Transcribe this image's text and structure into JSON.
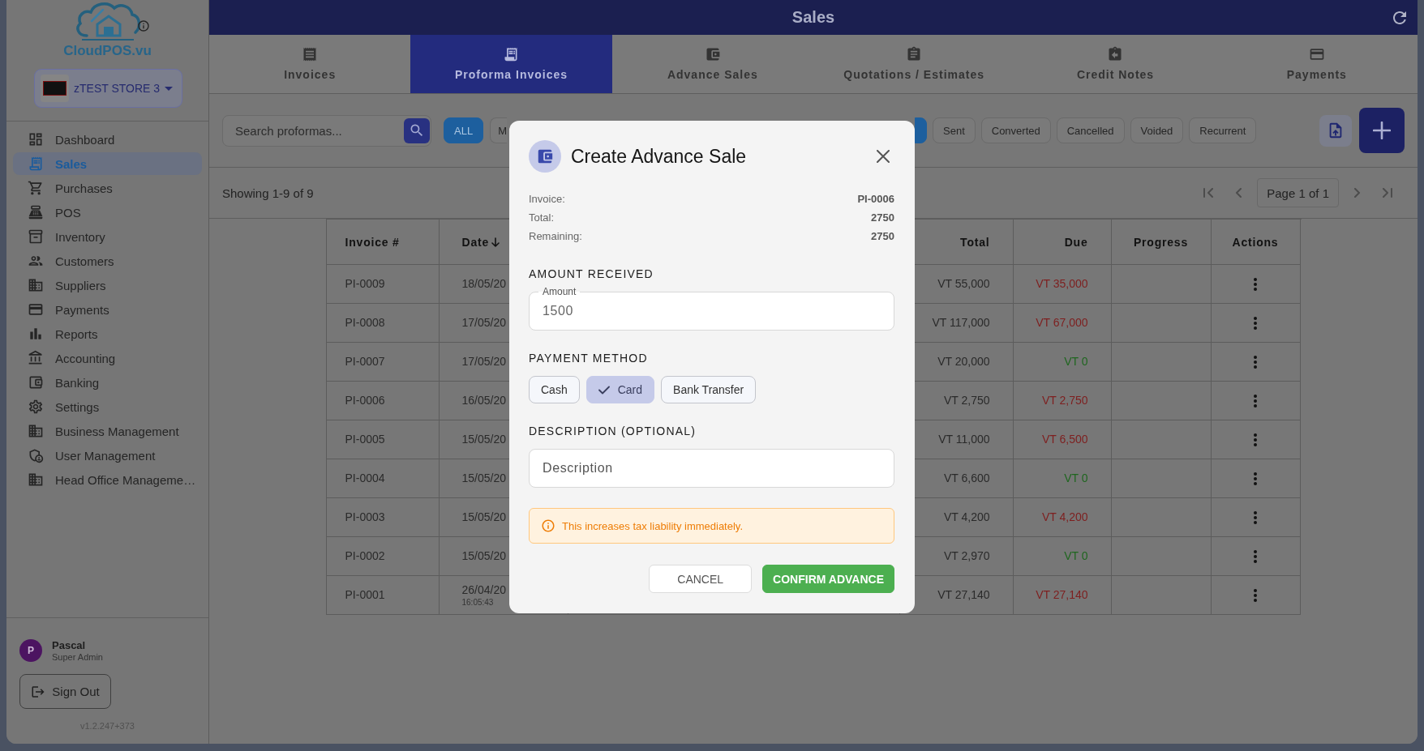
{
  "sidebar": {
    "logo_text": "CloudPOS.vu",
    "store_name": "zTEST STORE 3",
    "items": [
      {
        "label": "Dashboard",
        "selected": false
      },
      {
        "label": "Sales",
        "selected": true
      },
      {
        "label": "Purchases",
        "selected": false
      },
      {
        "label": "POS",
        "selected": false
      },
      {
        "label": "Inventory",
        "selected": false
      },
      {
        "label": "Customers",
        "selected": false
      },
      {
        "label": "Suppliers",
        "selected": false
      },
      {
        "label": "Payments",
        "selected": false
      },
      {
        "label": "Reports",
        "selected": false
      },
      {
        "label": "Accounting",
        "selected": false
      },
      {
        "label": "Banking",
        "selected": false
      },
      {
        "label": "Settings",
        "selected": false
      },
      {
        "label": "Business Management",
        "selected": false
      },
      {
        "label": "User Management",
        "selected": false
      },
      {
        "label": "Head Office Manageme…",
        "selected": false
      }
    ],
    "user": {
      "initial": "P",
      "name": "Pascal",
      "role": "Super Admin"
    },
    "sign_out": "Sign Out",
    "version": "v1.2.247+373"
  },
  "header": {
    "title": "Sales"
  },
  "tabs": [
    {
      "label": "Invoices",
      "selected": false
    },
    {
      "label": "Proforma Invoices",
      "selected": true
    },
    {
      "label": "Advance Sales",
      "selected": false
    },
    {
      "label": "Quotations / Estimates",
      "selected": false
    },
    {
      "label": "Credit Notes",
      "selected": false
    },
    {
      "label": "Payments",
      "selected": false
    }
  ],
  "toolbar": {
    "search": {
      "placeholder": "Search proformas..."
    },
    "type_filters": [
      {
        "label": "ALL",
        "selected": true
      },
      {
        "label": "M",
        "selected": false
      }
    ],
    "status_filters": [
      {
        "selected": true
      },
      {
        "label": "Sent",
        "selected": false
      },
      {
        "label": "Converted",
        "selected": false
      },
      {
        "label": "Cancelled",
        "selected": false
      },
      {
        "label": "Voided",
        "selected": false
      },
      {
        "label": "Recurrent",
        "selected": false
      }
    ]
  },
  "pagination": {
    "summary": "Showing 1-9 of 9",
    "page": "Page 1 of 1",
    "nav_buttons": [
      {
        "kind": "first",
        "disabled": true
      },
      {
        "kind": "previous",
        "disabled": true
      },
      {
        "kind": "next",
        "disabled": true
      },
      {
        "kind": "last",
        "disabled": true
      }
    ]
  },
  "table": {
    "columns": [
      {
        "label": "Invoice #"
      },
      {
        "label": "Date",
        "sorted": true
      },
      {
        "label": "Total"
      },
      {
        "label": "Due"
      },
      {
        "label": "Progress"
      },
      {
        "label": "Actions"
      }
    ],
    "rows": [
      {
        "invoice": "PI-0009",
        "date": "18/05/20",
        "total": "VT 55,000",
        "due": {
          "text": "VT 35,000",
          "color": "#7e1f1f"
        }
      },
      {
        "invoice": "PI-0008",
        "date": "17/05/20",
        "total": "VT 117,000",
        "due": {
          "text": "VT 67,000",
          "color": "#7e1f1f"
        }
      },
      {
        "invoice": "PI-0007",
        "date": "17/05/20",
        "total": "VT 20,000",
        "due": {
          "text": "VT 0",
          "color": "#1f661f"
        }
      },
      {
        "invoice": "PI-0006",
        "date": "16/05/20",
        "total": "VT 2,750",
        "due": {
          "text": "VT 2,750",
          "color": "#7e1f1f"
        }
      },
      {
        "invoice": "PI-0005",
        "date": "15/05/20",
        "total": "VT 11,000",
        "due": {
          "text": "VT 6,500",
          "color": "#7e1f1f"
        }
      },
      {
        "invoice": "PI-0004",
        "date": "15/05/20",
        "total": "VT 6,600",
        "due": {
          "text": "VT 0",
          "color": "#1f661f"
        }
      },
      {
        "invoice": "PI-0003",
        "date": "15/05/20",
        "total": "VT 4,200",
        "due": {
          "text": "VT 4,200",
          "color": "#7e1f1f"
        }
      },
      {
        "invoice": "PI-0002",
        "date": "15/05/20",
        "total": "VT 2,970",
        "due": {
          "text": "VT 0",
          "color": "#1f661f"
        }
      },
      {
        "invoice": "PI-0001",
        "date": "26/04/20",
        "time": "16:05:43",
        "total": "VT 27,140",
        "due": {
          "text": "VT 27,140",
          "color": "#7e1f1f"
        }
      }
    ]
  },
  "dialog": {
    "title": "Create Advance Sale",
    "summary": [
      {
        "label": "Invoice:",
        "value": "PI-0006"
      },
      {
        "label": "Total:",
        "value": "2750"
      },
      {
        "label": "Remaining:",
        "value": "2750"
      }
    ],
    "amount_heading": "AMOUNT RECEIVED",
    "amount_field": {
      "label": "Amount",
      "value": "1500"
    },
    "payment_heading": "PAYMENT METHOD",
    "payment_methods": [
      {
        "label": "Cash",
        "selected": false
      },
      {
        "label": "Card",
        "selected": true
      },
      {
        "label": "Bank Transfer",
        "selected": false
      }
    ],
    "description_heading": "DESCRIPTION (OPTIONAL)",
    "description_field": {
      "placeholder": "Description"
    },
    "notice": "This increases tax liability immediately.",
    "buttons": [
      {
        "label": "CANCEL",
        "kind": "secondary"
      },
      {
        "label": "CONFIRM ADVANCE",
        "kind": "primary"
      }
    ]
  }
}
